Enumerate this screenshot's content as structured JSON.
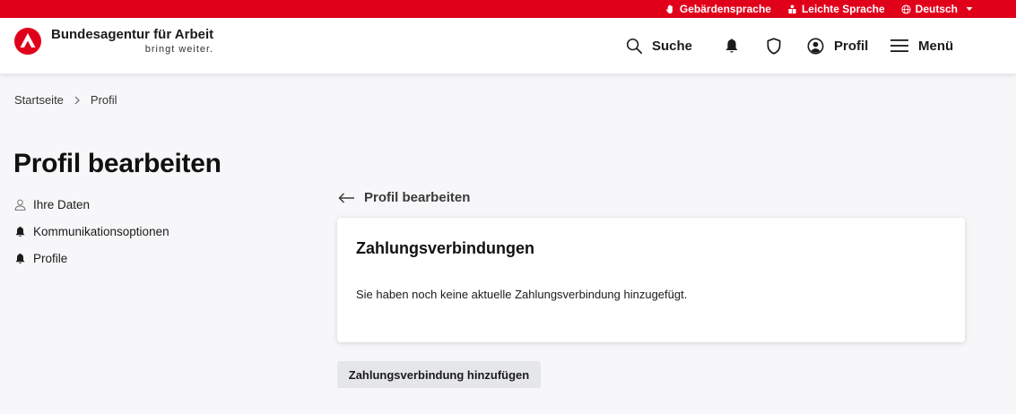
{
  "topbar": {
    "links": [
      {
        "label": "Gebärdensprache",
        "icon": "hand-icon"
      },
      {
        "label": "Leichte Sprache",
        "icon": "easy-language-icon"
      },
      {
        "label": "Deutsch",
        "icon": "globe-icon"
      }
    ],
    "color": "#e1001a"
  },
  "header": {
    "logo_name": "Bundesagentur für Arbeit",
    "logo_slogan": "bringt weiter.",
    "search_label": "Suche",
    "profil_label": "Profil",
    "menu_label": "Menü"
  },
  "breadcrumb": {
    "items": [
      "Startseite",
      "Profil"
    ],
    "separator": ">"
  },
  "page": {
    "title": "Profil bearbeiten"
  },
  "sidebar": {
    "items": [
      {
        "label": "Ihre Daten",
        "icon": "user-icon"
      },
      {
        "label": "Kommunikationsoptionen",
        "icon": "bell-icon"
      },
      {
        "label": "Profile",
        "icon": "bell-icon"
      }
    ]
  },
  "main": {
    "back_label": "Profil bearbeiten",
    "card_title": "Zahlungsverbindungen",
    "card_text": "Sie haben noch keine aktuelle Zahlungsverbindung hinzugefügt.",
    "add_button_label": "Zahlungsverbindung hinzufügen"
  }
}
